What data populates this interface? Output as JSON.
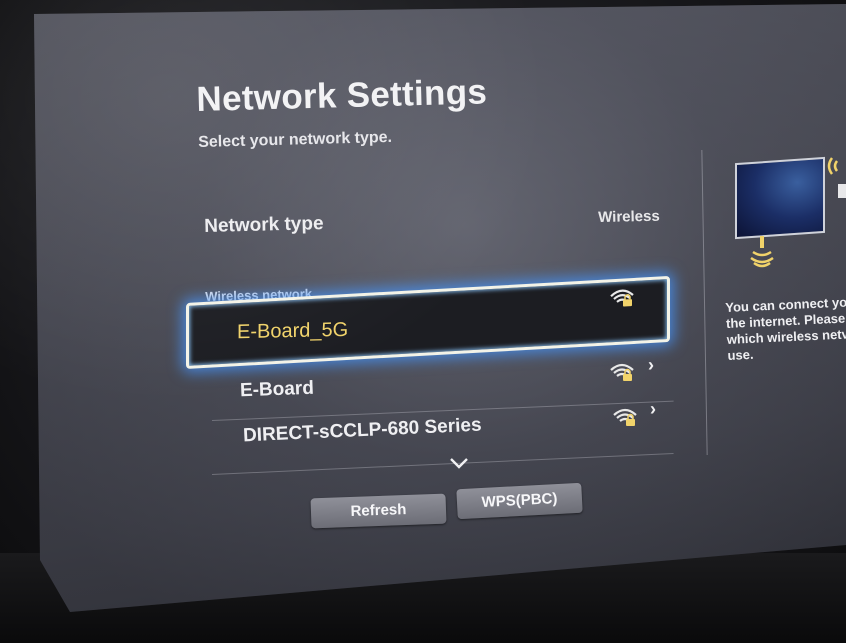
{
  "screen": {
    "title": "Network Settings",
    "subtitle": "Select your network type."
  },
  "network_type": {
    "label": "Network type",
    "value": "Wireless"
  },
  "wireless_section": {
    "header": "Wireless network",
    "networks": [
      {
        "name": "E-Board_5G",
        "selected": true,
        "secured": true,
        "has_arrow": false
      },
      {
        "name": "E-Board",
        "selected": false,
        "secured": true,
        "has_arrow": true
      },
      {
        "name": "DIRECT-sCCLP-680 Series",
        "selected": false,
        "secured": true,
        "has_arrow": true
      }
    ]
  },
  "buttons": {
    "refresh": "Refresh",
    "wps": "WPS(PBC)"
  },
  "help_panel": {
    "lines": [
      "You can connect yo",
      "the internet. Please",
      "which wireless netv",
      "use."
    ]
  },
  "colors": {
    "selected_text": "#f1d36a",
    "focus_glow": "#4696ff",
    "signal_icon": "#f1d36a"
  }
}
